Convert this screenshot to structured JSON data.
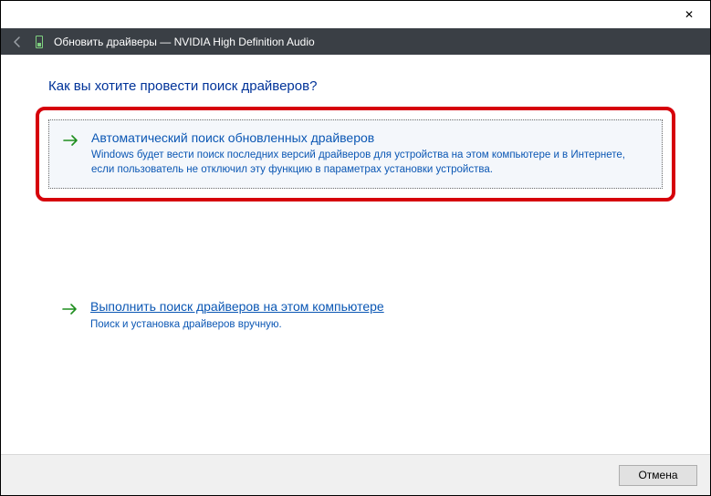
{
  "titlebar": {
    "close_glyph": "✕"
  },
  "header": {
    "title": "Обновить драйверы — NVIDIA High Definition Audio"
  },
  "content": {
    "heading": "Как вы хотите провести поиск драйверов?"
  },
  "options": {
    "auto": {
      "title": "Автоматический поиск обновленных драйверов",
      "desc": "Windows будет вести поиск последних версий драйверов для устройства на этом компьютере и в Интернете, если пользователь не отключил эту функцию в параметрах установки устройства."
    },
    "manual": {
      "title": "Выполнить поиск драйверов на этом компьютере",
      "desc": "Поиск и установка драйверов вручную."
    }
  },
  "footer": {
    "cancel": "Отмена"
  },
  "colors": {
    "accent_link": "#0b57b4",
    "highlight": "#d6000a",
    "headerbar": "#3a3f45"
  }
}
